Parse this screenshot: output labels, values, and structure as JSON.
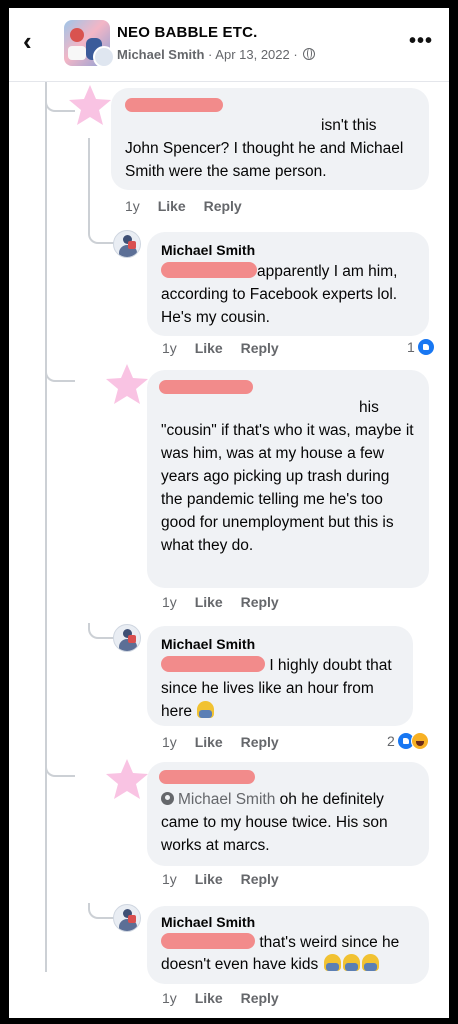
{
  "header": {
    "back_icon": "chevron-left-icon",
    "group_name": "NEO BABBLE ETC.",
    "author": "Michael Smith",
    "date": "Apr 13, 2022",
    "separator": "·",
    "privacy_icon": "globe-icon",
    "more_icon": "more-options-icon",
    "more_label": "•••"
  },
  "comments": [
    {
      "text_line1": "isn't this",
      "text_rest": "John Spencer? I thought he and Michael Smith were the same person.",
      "time": "1y",
      "like": "Like",
      "reply": "Reply"
    },
    {
      "author": "Michael Smith",
      "text": "apparently I am him, according to Facebook experts lol. He's my cousin.",
      "time": "1y",
      "like": "Like",
      "reply": "Reply",
      "reaction_count": "1"
    },
    {
      "text_line1": "his",
      "text_rest": "\"cousin\" if that's who it was, maybe it was him, was at my house a few years ago picking up trash during the pandemic telling me he's too good for unemployment but this is what they do.",
      "time": "1y",
      "like": "Like",
      "reply": "Reply"
    },
    {
      "author": "Michael Smith",
      "text": "I highly doubt that since he lives like an hour from here",
      "time": "1y",
      "like": "Like",
      "reply": "Reply",
      "reaction_count": "2"
    },
    {
      "mention": "Michael Smith",
      "text": "oh he definitely came to my house twice. His son works at marcs.",
      "time": "1y",
      "like": "Like",
      "reply": "Reply"
    },
    {
      "author": "Michael Smith",
      "text": "that's weird since he doesn't even have kids",
      "time": "1y",
      "like": "Like",
      "reply": "Reply"
    }
  ]
}
